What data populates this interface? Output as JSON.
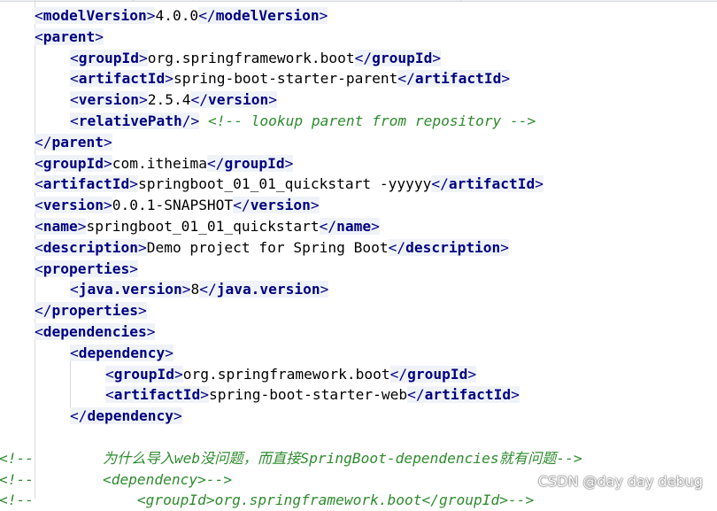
{
  "lines": [
    {
      "indent": 1,
      "parts": [
        [
          "open",
          "modelVersion"
        ],
        [
          "text",
          "4.0.0"
        ],
        [
          "close",
          "modelVersion"
        ]
      ]
    },
    {
      "indent": 1,
      "parts": [
        [
          "open",
          "parent"
        ]
      ]
    },
    {
      "indent": 2,
      "parts": [
        [
          "open",
          "groupId"
        ],
        [
          "text",
          "org.springframework.boot"
        ],
        [
          "close",
          "groupId"
        ]
      ]
    },
    {
      "indent": 2,
      "parts": [
        [
          "open",
          "artifactId"
        ],
        [
          "text",
          "spring-boot-starter-parent"
        ],
        [
          "close",
          "artifactId"
        ]
      ]
    },
    {
      "indent": 2,
      "parts": [
        [
          "open",
          "version"
        ],
        [
          "text",
          "2.5.4"
        ],
        [
          "close",
          "version"
        ]
      ]
    },
    {
      "indent": 2,
      "parts": [
        [
          "selfclose",
          "relativePath"
        ],
        [
          "text",
          " "
        ],
        [
          "comment",
          "<!-- lookup parent from repository -->"
        ]
      ]
    },
    {
      "indent": 1,
      "parts": [
        [
          "close",
          "parent"
        ]
      ]
    },
    {
      "indent": 1,
      "parts": [
        [
          "open",
          "groupId"
        ],
        [
          "text",
          "com.itheima"
        ],
        [
          "close",
          "groupId"
        ]
      ]
    },
    {
      "indent": 1,
      "parts": [
        [
          "open",
          "artifactId"
        ],
        [
          "text",
          "springboot_01_01_quickstart -yyyyy"
        ],
        [
          "close",
          "artifactId"
        ]
      ]
    },
    {
      "indent": 1,
      "parts": [
        [
          "open",
          "version"
        ],
        [
          "text",
          "0.0.1-SNAPSHOT"
        ],
        [
          "close",
          "version"
        ]
      ]
    },
    {
      "indent": 1,
      "parts": [
        [
          "open",
          "name"
        ],
        [
          "text",
          "springboot_01_01_quickstart"
        ],
        [
          "close",
          "name"
        ]
      ]
    },
    {
      "indent": 1,
      "parts": [
        [
          "open",
          "description"
        ],
        [
          "text",
          "Demo project for Spring Boot"
        ],
        [
          "close",
          "description"
        ]
      ]
    },
    {
      "indent": 1,
      "parts": [
        [
          "open",
          "properties"
        ]
      ]
    },
    {
      "indent": 2,
      "parts": [
        [
          "open",
          "java.version"
        ],
        [
          "text",
          "8"
        ],
        [
          "close",
          "java.version"
        ]
      ]
    },
    {
      "indent": 1,
      "parts": [
        [
          "close",
          "properties"
        ]
      ]
    },
    {
      "indent": 1,
      "parts": [
        [
          "open",
          "dependencies"
        ]
      ]
    },
    {
      "indent": 2,
      "parts": [
        [
          "open",
          "dependency"
        ]
      ]
    },
    {
      "indent": 3,
      "parts": [
        [
          "open",
          "groupId"
        ],
        [
          "text",
          "org.springframework.boot"
        ],
        [
          "close",
          "groupId"
        ]
      ]
    },
    {
      "indent": 3,
      "parts": [
        [
          "open",
          "artifactId"
        ],
        [
          "text",
          "spring-boot-starter-web"
        ],
        [
          "close",
          "artifactId"
        ]
      ]
    },
    {
      "indent": 2,
      "parts": [
        [
          "close",
          "dependency"
        ]
      ]
    },
    {
      "indent": 0,
      "parts": []
    },
    {
      "indent": 0,
      "parts": [
        [
          "comment",
          "<!--        为什么导入web没问题，而直接SpringBoot-dependencies就有问题-->"
        ]
      ]
    },
    {
      "indent": 0,
      "parts": [
        [
          "comment",
          "<!--        <dependency>-->"
        ]
      ]
    },
    {
      "indent": 0,
      "parts": [
        [
          "comment",
          "<!--            <groupId>org.springframework.boot</groupId>-->"
        ]
      ]
    }
  ],
  "watermark": "CSDN @day day debug"
}
